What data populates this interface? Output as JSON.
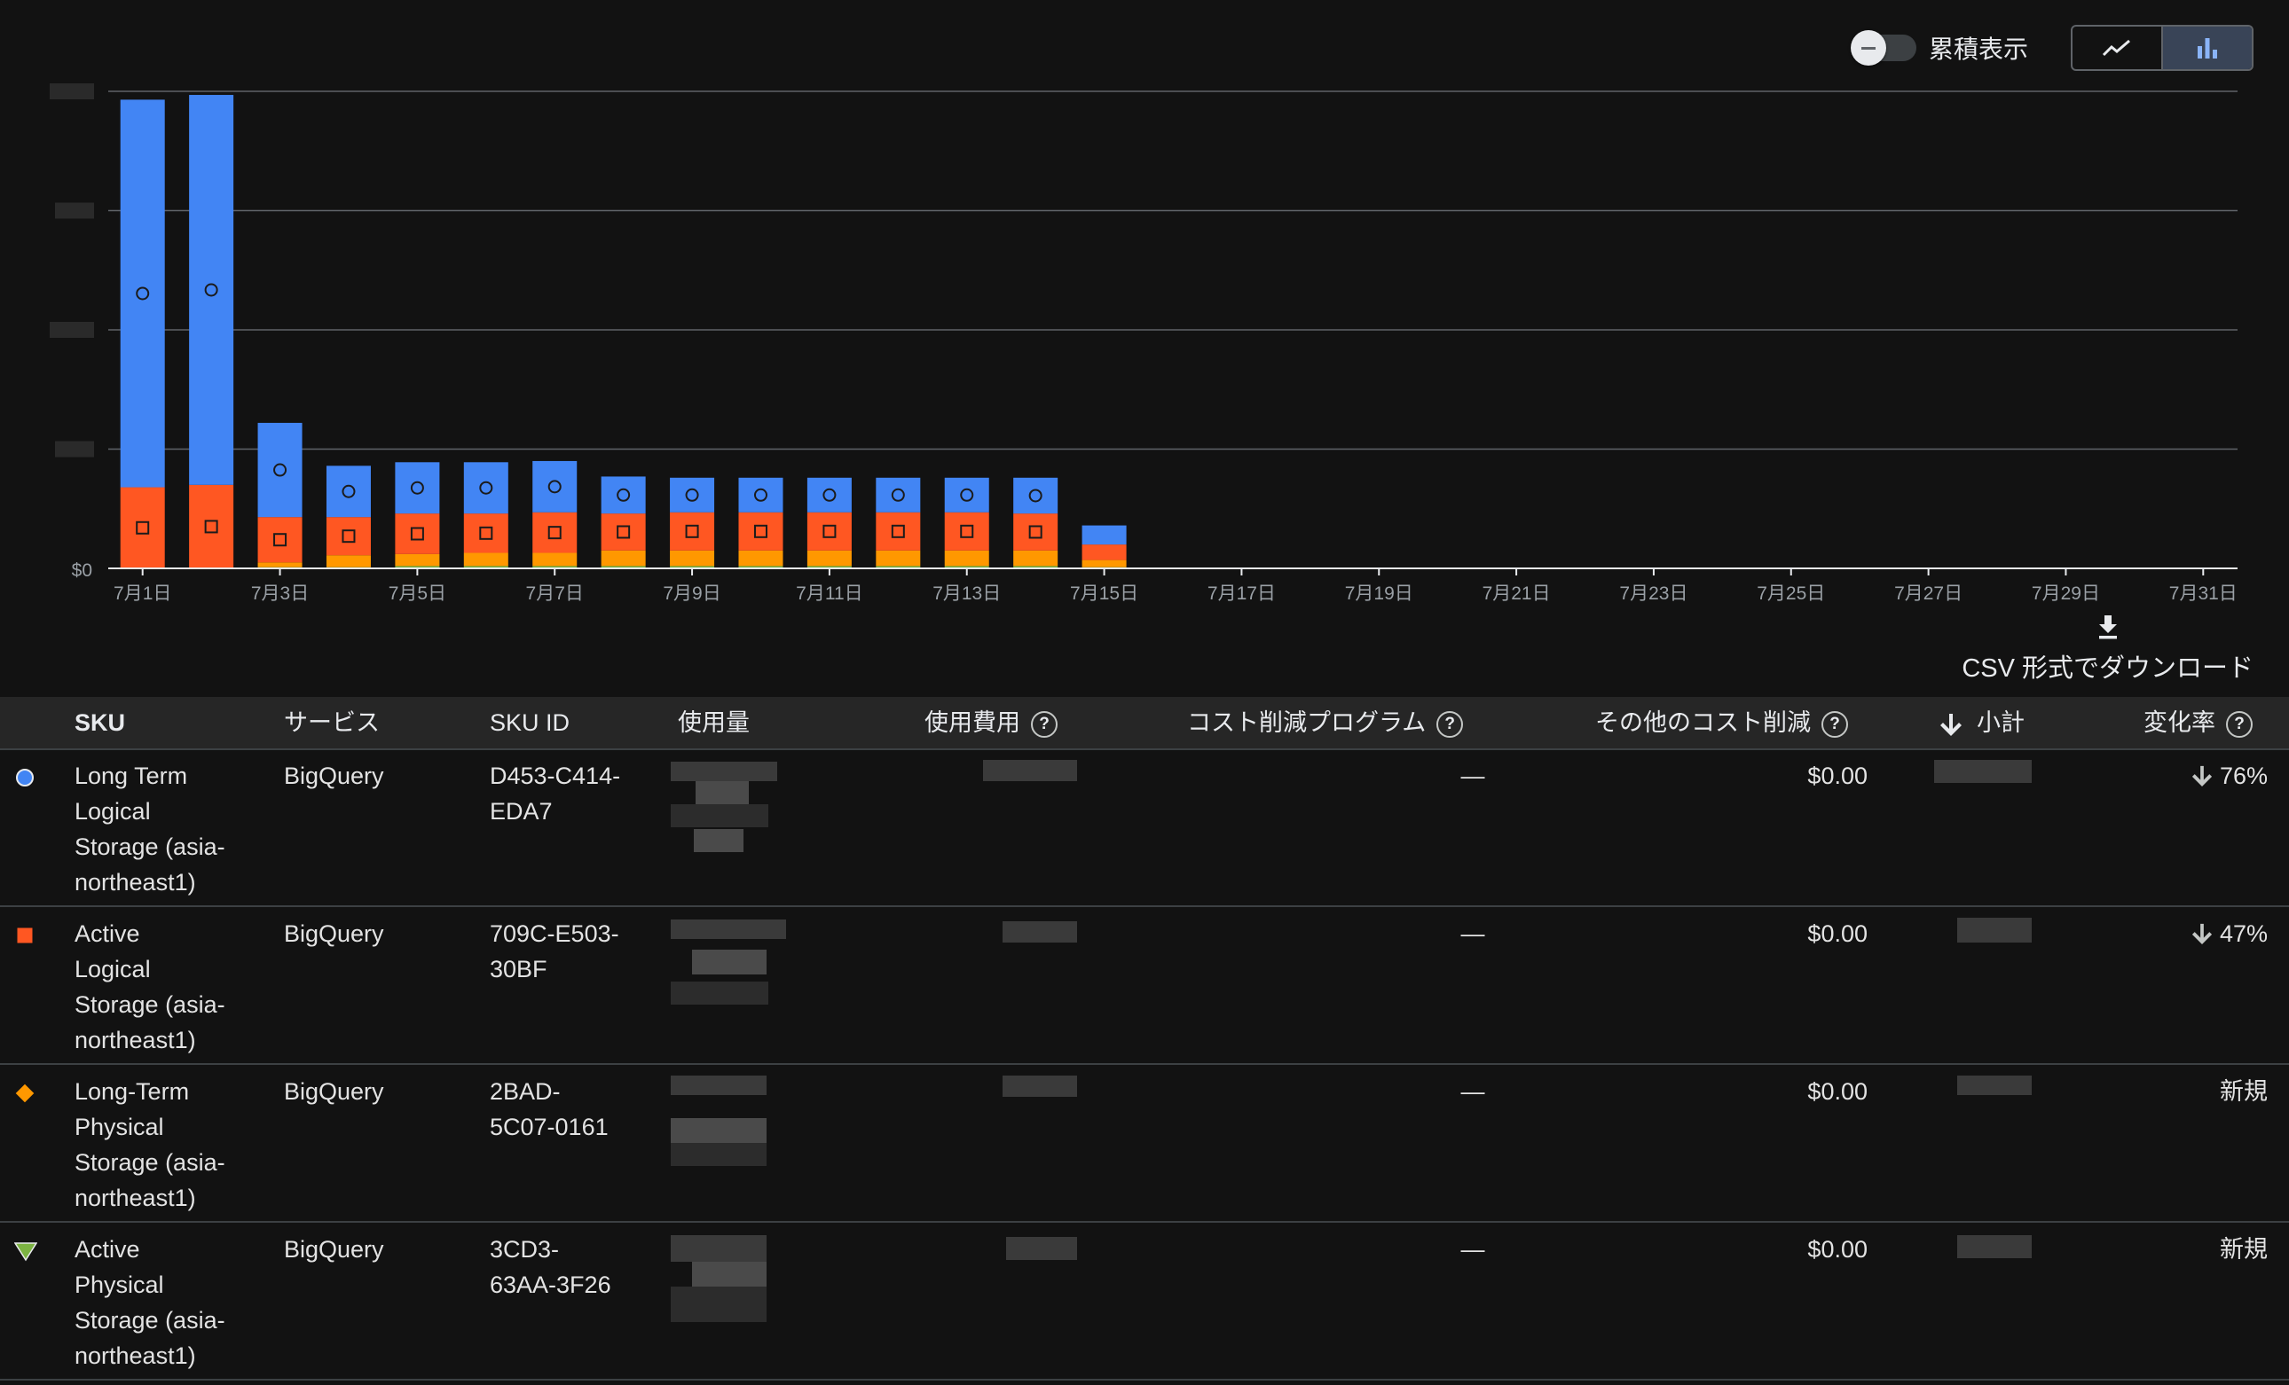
{
  "controls": {
    "cumulative_label": "累積表示",
    "line_icon": "line-chart-icon",
    "bar_icon": "bar-chart-icon",
    "active_view": "bar"
  },
  "chart_data": {
    "type": "bar",
    "stacked": true,
    "y_tick_labels": [
      "$0"
    ],
    "x_tick_labels": [
      "7月1日",
      "7月3日",
      "7月5日",
      "7月7日",
      "7月9日",
      "7月11日",
      "7月13日",
      "7月15日",
      "7月17日",
      "7月19日",
      "7月21日",
      "7月23日",
      "7月25日",
      "7月27日",
      "7月29日",
      "7月31日"
    ],
    "categories": [
      "7月1日",
      "7月2日",
      "7月3日",
      "7月4日",
      "7月5日",
      "7月6日",
      "7月7日",
      "7月8日",
      "7月9日",
      "7月10日",
      "7月11日",
      "7月12日",
      "7月13日",
      "7月14日",
      "7月15日",
      "7月16日",
      "7月17日",
      "7月18日",
      "7月19日",
      "7月20日",
      "7月21日",
      "7月22日",
      "7月23日",
      "7月24日",
      "7月25日",
      "7月26日",
      "7月27日",
      "7月28日",
      "7月29日",
      "7月30日",
      "7月31日"
    ],
    "ylim": [
      0,
      4
    ],
    "grid": true,
    "series": [
      {
        "color": "#7cb342",
        "marker": "triangle",
        "values": [
          0,
          0,
          0.01,
          0.01,
          0.02,
          0.02,
          0.02,
          0.02,
          0.02,
          0.02,
          0.02,
          0.02,
          0.02,
          0.02,
          0.01,
          0,
          0,
          0,
          0,
          0,
          0,
          0,
          0,
          0,
          0,
          0,
          0,
          0,
          0,
          0,
          0
        ]
      },
      {
        "color": "#ff9800",
        "marker": "diamond",
        "values": [
          0,
          0,
          0.04,
          0.1,
          0.1,
          0.11,
          0.11,
          0.13,
          0.13,
          0.13,
          0.13,
          0.13,
          0.13,
          0.13,
          0.06,
          0,
          0,
          0,
          0,
          0,
          0,
          0,
          0,
          0,
          0,
          0,
          0,
          0,
          0,
          0,
          0
        ]
      },
      {
        "color": "#ff5722",
        "marker": "square",
        "values": [
          0.68,
          0.7,
          0.38,
          0.32,
          0.34,
          0.33,
          0.34,
          0.31,
          0.32,
          0.32,
          0.32,
          0.32,
          0.32,
          0.31,
          0.13,
          0,
          0,
          0,
          0,
          0,
          0,
          0,
          0,
          0,
          0,
          0,
          0,
          0,
          0,
          0,
          0
        ]
      },
      {
        "color": "#4285f4",
        "marker": "circle",
        "values": [
          3.25,
          3.27,
          0.79,
          0.43,
          0.43,
          0.43,
          0.43,
          0.31,
          0.29,
          0.29,
          0.29,
          0.29,
          0.29,
          0.3,
          0.16,
          0,
          0,
          0,
          0,
          0,
          0,
          0,
          0,
          0,
          0,
          0,
          0,
          0,
          0,
          0,
          0
        ]
      }
    ]
  },
  "download": {
    "label": "CSV 形式でダウンロード",
    "icon": "download-icon"
  },
  "table": {
    "headers": {
      "sku": "SKU",
      "service": "サービス",
      "sku_id": "SKU ID",
      "usage": "使用量",
      "usage_cost": "使用費用",
      "savings_programs": "コスト削減プログラム",
      "other_savings": "その他のコスト削減",
      "subtotal": "小計",
      "change": "変化率"
    },
    "help_icon": "help-icon",
    "sort_icon": "arrow-down-icon",
    "rows": [
      {
        "marker": "circle",
        "color": "#4285f4",
        "sku": [
          "Long Term",
          "Logical",
          "Storage (asia-",
          "northeast1)"
        ],
        "service": "BigQuery",
        "sku_id": [
          "D453-C414-",
          "EDA7"
        ],
        "savings_programs": "—",
        "other_savings": "$0.00",
        "change": "76%",
        "change_icon": "arrow-down-icon"
      },
      {
        "marker": "square",
        "color": "#ff5722",
        "sku": [
          "Active",
          "Logical",
          "Storage (asia-",
          "northeast1)"
        ],
        "service": "BigQuery",
        "sku_id": [
          "709C-E503-",
          "30BF"
        ],
        "savings_programs": "—",
        "other_savings": "$0.00",
        "change": "47%",
        "change_icon": "arrow-down-icon"
      },
      {
        "marker": "diamond",
        "color": "#ff9800",
        "sku": [
          "Long-Term",
          "Physical",
          "Storage (asia-",
          "northeast1)"
        ],
        "service": "BigQuery",
        "sku_id": [
          "2BAD-",
          "5C07-0161"
        ],
        "savings_programs": "—",
        "other_savings": "$0.00",
        "change": "新規",
        "change_icon": ""
      },
      {
        "marker": "triangle",
        "color": "#7cb342",
        "sku": [
          "Active",
          "Physical",
          "Storage (asia-",
          "northeast1)"
        ],
        "service": "BigQuery",
        "sku_id": [
          "3CD3-",
          "63AA-3F26"
        ],
        "savings_programs": "—",
        "other_savings": "$0.00",
        "change": "新規",
        "change_icon": ""
      }
    ]
  }
}
